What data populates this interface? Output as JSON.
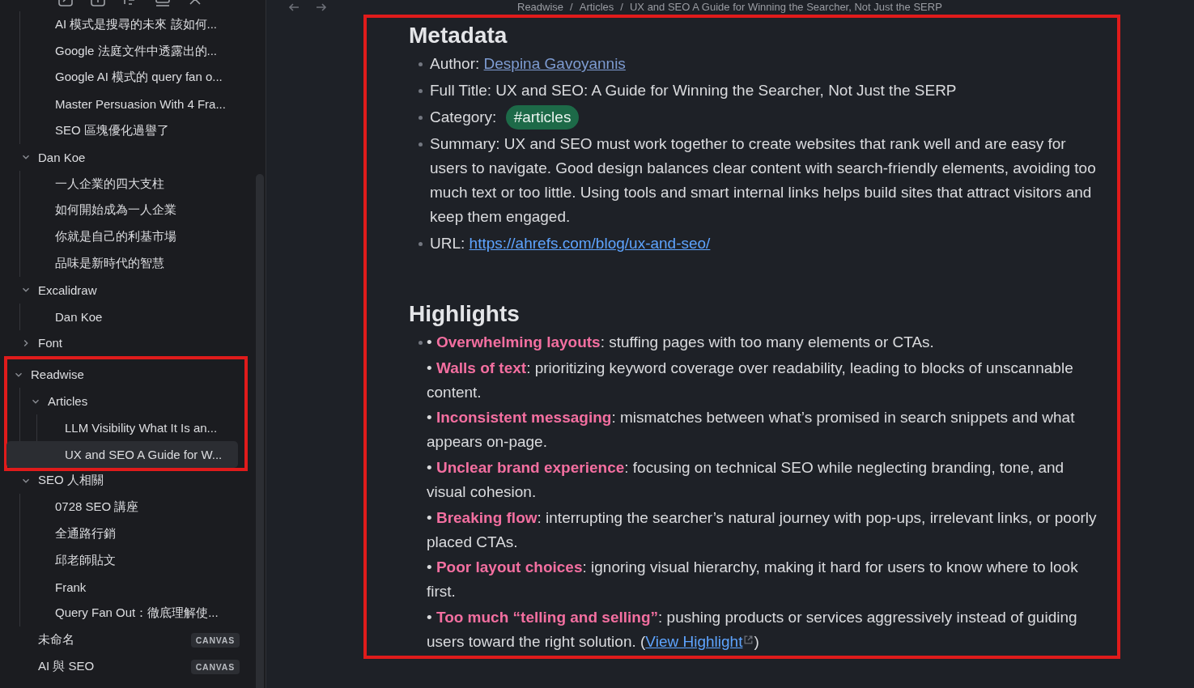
{
  "sidebar": {
    "tree": [
      {
        "kind": "continued",
        "children": [
          {
            "kind": "file",
            "label": "AI 模式是搜尋的未來 該如何...",
            "selected": false
          },
          {
            "kind": "file",
            "label": "Google 法庭文件中透露出的...",
            "selected": false
          },
          {
            "kind": "file",
            "label": "Google AI 模式的 query fan o...",
            "selected": false
          },
          {
            "kind": "file",
            "label": "Master Persuasion With 4 Fra...",
            "selected": false
          },
          {
            "kind": "file",
            "label": "SEO 區塊優化過譽了",
            "selected": false
          }
        ]
      },
      {
        "kind": "folder",
        "label": "Dan Koe",
        "expanded": true,
        "children": [
          {
            "kind": "file",
            "label": "一人企業的四大支柱",
            "selected": false
          },
          {
            "kind": "file",
            "label": "如何開始成為一人企業",
            "selected": false
          },
          {
            "kind": "file",
            "label": "你就是自己的利基市場",
            "selected": false
          },
          {
            "kind": "file",
            "label": "品味是新時代的智慧",
            "selected": false
          }
        ]
      },
      {
        "kind": "folder",
        "label": "Excalidraw",
        "expanded": true,
        "children": [
          {
            "kind": "file",
            "label": "Dan Koe",
            "selected": false
          }
        ]
      },
      {
        "kind": "folder",
        "label": "Font",
        "expanded": false
      },
      {
        "kind": "folder",
        "label": "Readwise",
        "expanded": true,
        "annotation_frame": true,
        "children": [
          {
            "kind": "folder",
            "label": "Articles",
            "expanded": true,
            "children": [
              {
                "kind": "file",
                "label": "LLM Visibility What It Is an...",
                "selected": false
              },
              {
                "kind": "file",
                "label": "UX and SEO A Guide for W...",
                "selected": true
              }
            ]
          }
        ]
      },
      {
        "kind": "folder",
        "label": "SEO 人相關",
        "expanded": true,
        "children": [
          {
            "kind": "file",
            "label": "0728 SEO 講座",
            "selected": false
          },
          {
            "kind": "file",
            "label": "全通路行銷",
            "selected": false
          },
          {
            "kind": "file",
            "label": "邱老師貼文",
            "selected": false
          },
          {
            "kind": "file",
            "label": "Frank",
            "selected": false
          },
          {
            "kind": "file",
            "label": "Query Fan Out：徹底理解使...",
            "selected": false
          }
        ]
      },
      {
        "kind": "file",
        "label": "未命名",
        "selected": false,
        "badge": "CANVAS"
      },
      {
        "kind": "file",
        "label": "AI 與 SEO",
        "selected": false,
        "badge": "CANVAS"
      }
    ]
  },
  "breadcrumb": {
    "separator": "/",
    "items": [
      "Readwise",
      "Articles",
      "UX and SEO A Guide for Winning the Searcher, Not Just the SERP"
    ]
  },
  "note": {
    "annotation_frame": true,
    "metadata": {
      "heading": "Metadata",
      "items": [
        {
          "kind": "link",
          "label": "Author: ",
          "value": "Despina Gavoyannis"
        },
        {
          "kind": "text",
          "label": "Full Title: ",
          "value": "UX and SEO: A Guide for Winning the Searcher, Not Just the SERP"
        },
        {
          "kind": "tag",
          "label": "Category: ",
          "value": "#articles"
        },
        {
          "kind": "text",
          "label": "Summary: ",
          "value": "UX and SEO must work together to create websites that rank well and are easy for users to navigate. Good design balances clear content with search-friendly elements, avoiding too much text or too little. Using tools and smart internal links helps build sites that attract visitors and keep them engaged."
        },
        {
          "kind": "url",
          "label": "URL: ",
          "value": "https://ahrefs.com/blog/ux-and-seo/"
        }
      ]
    },
    "highlights": {
      "heading": "Highlights",
      "items": [
        {
          "bullet": "•",
          "term": "Overwhelming layouts",
          "text": ": stuffing pages with too many elements or CTAs."
        },
        {
          "bullet": "•",
          "term": "Walls of text",
          "text": ": prioritizing keyword coverage over readability, leading to blocks of unscannable content."
        },
        {
          "bullet": "•",
          "term": "Inconsistent messaging",
          "text": ": mismatches between what’s promised in search snippets and what appears on-page."
        },
        {
          "bullet": "•",
          "term": "Unclear brand experience",
          "text": ": focusing on technical SEO while neglecting branding, tone, and visual cohesion."
        },
        {
          "bullet": "•",
          "term": "Breaking flow",
          "text": ": interrupting the searcher’s natural journey with pop-ups, irrelevant links, or poorly placed CTAs."
        },
        {
          "bullet": "•",
          "term": "Poor layout choices",
          "text": ": ignoring visual hierarchy, making it hard for users to know where to look first."
        },
        {
          "bullet": "•",
          "term": "Too much “telling and selling”",
          "text": ": pushing products or services aggressively instead of guiding users toward the right solution. (",
          "link": "View Highlight",
          "after": ")"
        }
      ]
    }
  }
}
